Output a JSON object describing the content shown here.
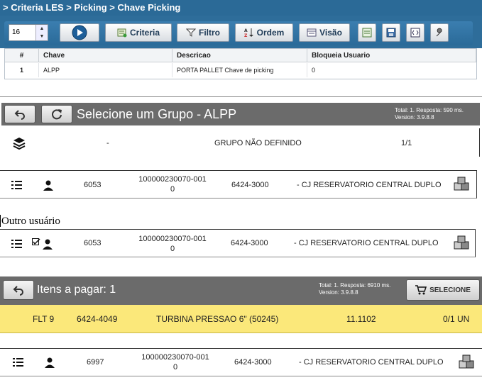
{
  "section1": {
    "breadcrumb": "> Criteria LES > Picking > Chave Picking",
    "page_size_value": "16",
    "toolbar": {
      "criteria_label": "Criteria",
      "filtro_label": "Filtro",
      "ordem_label": "Ordem",
      "visao_label": "Visão"
    },
    "table": {
      "headers": [
        "#",
        "Chave",
        "Descricao",
        "Bloqueia Usuario"
      ],
      "rows": [
        [
          "1",
          "ALPP",
          "PORTA PALLET Chave de picking",
          "0"
        ]
      ]
    }
  },
  "section2": {
    "title": "Selecione um Grupo - ALPP",
    "info_total": "Total: 1. Resposta: 590 ms.",
    "info_version": "Version: 3.9.8.8",
    "group_row": {
      "dash": "-",
      "name": "GRUPO NÃO DEFINIDO",
      "count": "1/1"
    }
  },
  "row_a": {
    "code": "6053",
    "doc_line1": "100000230070-001",
    "doc_line2": "0",
    "ref": "6424-3000",
    "desc": "- CJ RESERVATORIO CENTRAL DUPLO"
  },
  "note_label": "Outro usuário",
  "row_b": {
    "code": "6053",
    "doc_line1": "100000230070-001",
    "doc_line2": "0",
    "ref": "6424-3000",
    "desc": "- CJ RESERVATORIO CENTRAL DUPLO"
  },
  "section4": {
    "title": "Itens a pagar: 1",
    "info_total": "Total: 1. Resposta: 6910 ms.",
    "info_version": "Version: 3.9.8.8",
    "select_button": "SELECIONE",
    "item": {
      "location": "FLT 9",
      "ref": "6424-4049",
      "desc": "TURBINA PRESSAO 6\" (50245)",
      "qty": "11.1102",
      "progress": "0/1 UN"
    }
  },
  "row_c": {
    "code": "6997",
    "doc_line1": "100000230070-001",
    "doc_line2": "0",
    "ref": "6424-3000",
    "desc": "- CJ RESERVATORIO CENTRAL DUPLO"
  },
  "colors": {
    "title_bar": "#2b6a97",
    "dark_header": "#6b6b6b",
    "highlight_row": "#fbe87a"
  }
}
